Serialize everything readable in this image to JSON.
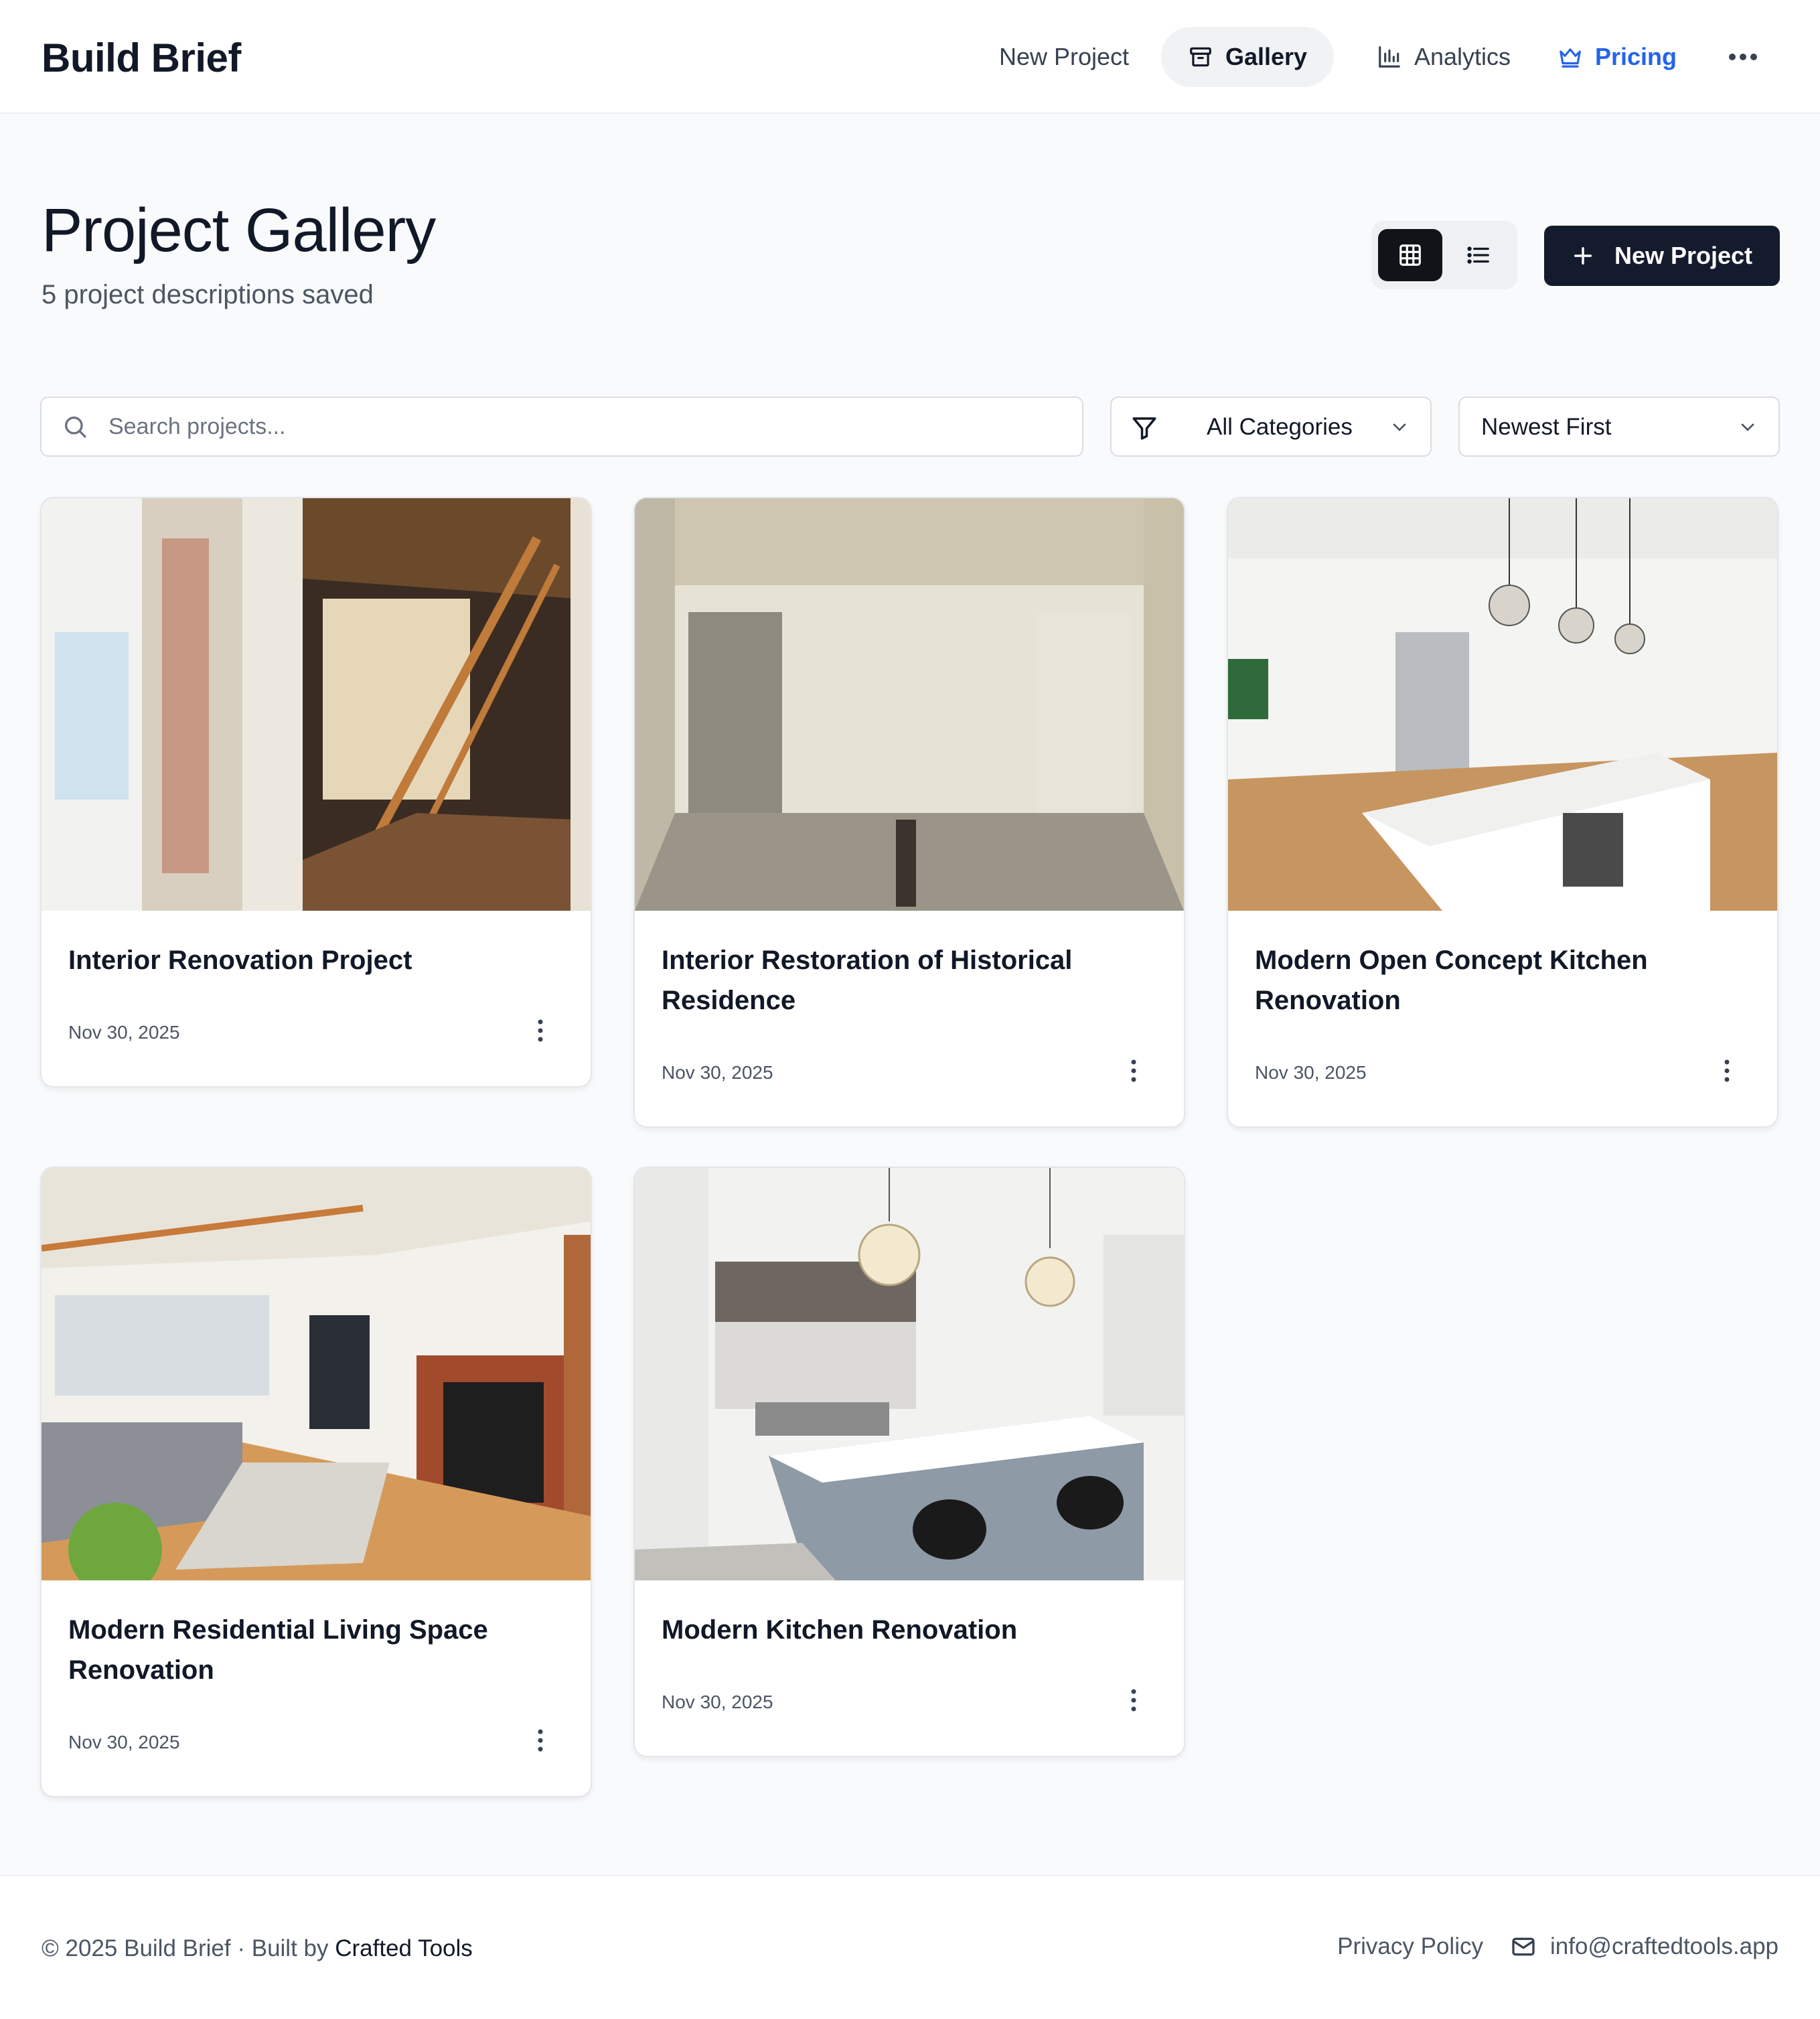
{
  "app": {
    "brand": "Build Brief"
  },
  "nav": {
    "new_project": "New Project",
    "gallery": "Gallery",
    "analytics": "Analytics",
    "pricing": "Pricing",
    "more_icon": "more-horizontal-icon"
  },
  "page": {
    "title": "Project Gallery",
    "subtitle": "5 project descriptions saved",
    "new_project_button": "New Project",
    "view_mode": "grid"
  },
  "filters": {
    "search_placeholder": "Search projects...",
    "search_value": "",
    "category": "All Categories",
    "sort": "Newest First"
  },
  "projects": [
    {
      "title": "Interior Renovation Project",
      "date": "Nov 30, 2025",
      "image": "interior-demolition-photo"
    },
    {
      "title": "Interior Restoration of Historical Residence",
      "date": "Nov 30, 2025",
      "image": "empty-room-restoration-photo"
    },
    {
      "title": "Modern Open Concept Kitchen Renovation",
      "date": "Nov 30, 2025",
      "image": "white-kitchen-island-photo"
    },
    {
      "title": "Modern Residential Living Space Renovation",
      "date": "Nov 30, 2025",
      "image": "living-room-fireplace-photo"
    },
    {
      "title": "Modern Kitchen Renovation",
      "date": "Nov 30, 2025",
      "image": "kitchen-chandelier-photo"
    }
  ],
  "footer": {
    "copyright": "© 2025 Build Brief · Built by ",
    "built_by": "Crafted Tools",
    "privacy": "Privacy Policy",
    "email": "info@craftedtools.app"
  },
  "colors": {
    "accent": "#2563eb",
    "primary_button": "#141b2d",
    "background": "#f9fafb"
  }
}
